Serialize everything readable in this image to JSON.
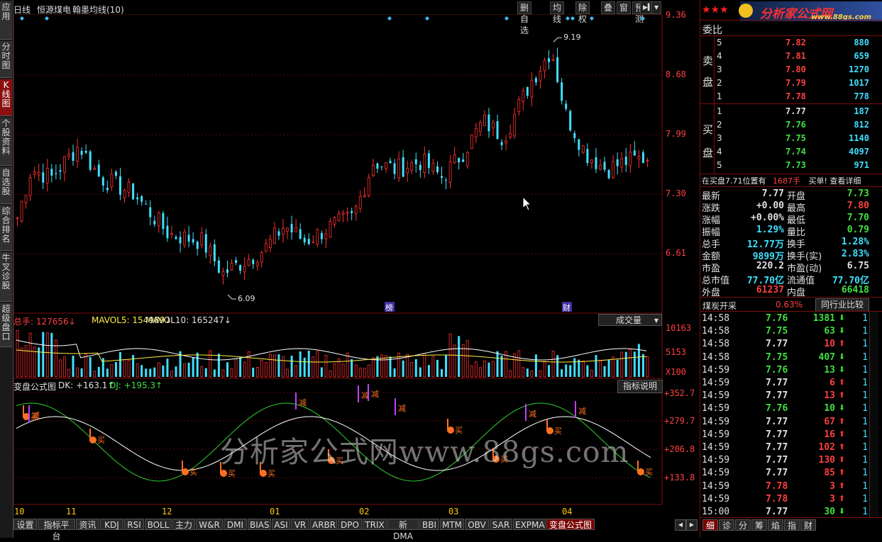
{
  "left_nav": [
    {
      "label": "应用",
      "active": false
    },
    {
      "label": "分时图",
      "active": false
    },
    {
      "label": "K线图",
      "active": true
    },
    {
      "label": "个股资料",
      "active": false
    },
    {
      "label": "自选股",
      "active": false
    },
    {
      "label": "综合排名",
      "active": false
    },
    {
      "label": "牛叉诊股",
      "active": false
    },
    {
      "label": "超级盘口",
      "active": false
    }
  ],
  "title": {
    "period": "日线",
    "stock": "恒源煤电",
    "indicator": "翰墨均线(10)"
  },
  "toolbar": [
    "删自选",
    "均线",
    "除权",
    "叠",
    "窗",
    "预测"
  ],
  "price_axis": [
    "9.36",
    "8.68",
    "7.99",
    "7.30",
    "6.61"
  ],
  "annotations": {
    "high": "9.19",
    "low": "6.09",
    "marker1": "榜",
    "marker2": "财"
  },
  "volume": {
    "label_total": "总手: 127656↓",
    "label_ma5": "MAVOL5: 154989↓",
    "label_ma10": "MAVOL10: 165247↓",
    "dropdown": "成交量",
    "axis": [
      "10163",
      "5153",
      "X100"
    ]
  },
  "indicator_panel": {
    "name": "变盘公式图",
    "dk": "DK: +163.1↑",
    "dj": "DJ: +195.3↑",
    "help_button": "指标说明",
    "axis": [
      "+352.7",
      "+279.7",
      "+206.8",
      "+133.8"
    ],
    "buy_label": "买",
    "sell_label": "减"
  },
  "watermark": "分析家公式网www.88gs.com",
  "x_axis": [
    "10",
    "11",
    "12",
    "01",
    "02",
    "03",
    "04"
  ],
  "bottom_tabs": [
    "设置",
    "指标平台",
    "资讯",
    "KDJ",
    "RSI",
    "BOLL",
    "主力",
    "W&R",
    "DMI",
    "BIAS",
    "ASI",
    "VR",
    "ARBR",
    "DPO",
    "TRIX",
    "新DMA",
    "BBI",
    "MTM",
    "OBV",
    "SAR",
    "EXPMA",
    "变盘公式图"
  ],
  "logo": {
    "stars": "★★★",
    "text": "分析家公式网",
    "url": "www.88gs.com"
  },
  "order_book": {
    "ratio_label": "委比",
    "sell_label_1": "卖",
    "sell_label_2": "盘",
    "buy_label_1": "买",
    "buy_label_2": "盘",
    "sell": [
      {
        "level": "5",
        "price": "7.82",
        "vol": "880"
      },
      {
        "level": "4",
        "price": "7.81",
        "vol": "659"
      },
      {
        "level": "3",
        "price": "7.80",
        "vol": "1270"
      },
      {
        "level": "2",
        "price": "7.79",
        "vol": "1017"
      },
      {
        "level": "1",
        "price": "7.78",
        "vol": "778"
      }
    ],
    "buy": [
      {
        "level": "1",
        "price": "7.77",
        "vol": "187"
      },
      {
        "level": "2",
        "price": "7.76",
        "vol": "812"
      },
      {
        "level": "3",
        "price": "7.75",
        "vol": "1140"
      },
      {
        "level": "4",
        "price": "7.74",
        "vol": "4097"
      },
      {
        "level": "5",
        "price": "7.73",
        "vol": "971"
      }
    ],
    "info_line": "在买盘7.71位置有",
    "info_vol": "1687手",
    "info_buy": "买单!",
    "info_link": "查看详细"
  },
  "quote": [
    {
      "k1": "最新",
      "v1": "7.77",
      "c1": "#e0e0e0",
      "k2": "开盘",
      "v2": "7.73",
      "c2": "#40e040"
    },
    {
      "k1": "涨跌",
      "v1": "+0.00",
      "c1": "#e0e0e0",
      "k2": "最高",
      "v2": "7.80",
      "c2": "#ff4040"
    },
    {
      "k1": "涨幅",
      "v1": "+0.00%",
      "c1": "#e0e0e0",
      "k2": "最低",
      "v2": "7.70",
      "c2": "#40e040"
    },
    {
      "k1": "振幅",
      "v1": "1.29%",
      "c1": "#40e0ff",
      "k2": "量比",
      "v2": "0.79",
      "c2": "#40e040"
    },
    {
      "k1": "总手",
      "v1": "12.77万",
      "c1": "#40e0ff",
      "k2": "换手",
      "v2": "1.28%",
      "c2": "#40e0ff"
    },
    {
      "k1": "金额",
      "v1": "9899万",
      "c1": "#40e0ff",
      "k2": "换手(实)",
      "v2": "2.83%",
      "c2": "#40e0ff"
    },
    {
      "k1": "市盈",
      "v1": "220.2",
      "c1": "#e0e0e0",
      "k2": "市盈(动)",
      "v2": "6.75",
      "c2": "#e0e0e0"
    },
    {
      "k1": "总市值",
      "v1": "77.70亿",
      "c1": "#40e0ff",
      "k2": "流通值",
      "v2": "77.70亿",
      "c2": "#40e0ff"
    },
    {
      "k1": "外盘",
      "v1": "61237",
      "c1": "#ff4040",
      "k2": "内盘",
      "v2": "66418",
      "c2": "#40e040"
    }
  ],
  "sector": {
    "name": "煤炭开采",
    "change": "0.63%",
    "compare_button": "同行业比较"
  },
  "ticks": [
    {
      "t": "14:58",
      "p": "7.76",
      "pc": "#40e040",
      "v": "1381",
      "dir": "down",
      "n": "1"
    },
    {
      "t": "14:58",
      "p": "7.75",
      "pc": "#40e040",
      "v": "63",
      "dir": "down",
      "n": "1"
    },
    {
      "t": "14:58",
      "p": "7.77",
      "pc": "#e0e0e0",
      "v": "10",
      "dir": "up",
      "n": "1"
    },
    {
      "t": "14:58",
      "p": "7.75",
      "pc": "#40e040",
      "v": "407",
      "dir": "down",
      "n": "1"
    },
    {
      "t": "14:59",
      "p": "7.76",
      "pc": "#40e040",
      "v": "13",
      "dir": "down",
      "n": "1"
    },
    {
      "t": "14:59",
      "p": "7.77",
      "pc": "#e0e0e0",
      "v": "6",
      "dir": "up",
      "n": "1"
    },
    {
      "t": "14:59",
      "p": "7.77",
      "pc": "#e0e0e0",
      "v": "13",
      "dir": "up",
      "n": "1"
    },
    {
      "t": "14:59",
      "p": "7.76",
      "pc": "#40e040",
      "v": "10",
      "dir": "down",
      "n": "1"
    },
    {
      "t": "14:59",
      "p": "7.77",
      "pc": "#e0e0e0",
      "v": "67",
      "dir": "up",
      "n": "1"
    },
    {
      "t": "14:59",
      "p": "7.77",
      "pc": "#e0e0e0",
      "v": "16",
      "dir": "up",
      "n": "1"
    },
    {
      "t": "14:59",
      "p": "7.77",
      "pc": "#e0e0e0",
      "v": "102",
      "dir": "up",
      "n": "1"
    },
    {
      "t": "14:59",
      "p": "7.77",
      "pc": "#e0e0e0",
      "v": "130",
      "dir": "up",
      "n": "1"
    },
    {
      "t": "14:59",
      "p": "7.77",
      "pc": "#e0e0e0",
      "v": "85",
      "dir": "up",
      "n": "1"
    },
    {
      "t": "14:59",
      "p": "7.78",
      "pc": "#ff4040",
      "v": "3",
      "dir": "up",
      "n": "1"
    },
    {
      "t": "14:59",
      "p": "7.78",
      "pc": "#ff4040",
      "v": "3",
      "dir": "up",
      "n": "1"
    },
    {
      "t": "15:00",
      "p": "7.77",
      "pc": "#e0e0e0",
      "v": "30",
      "dir": "down",
      "n": "1"
    }
  ],
  "right_tabs": [
    "细",
    "诊",
    "分",
    "筹",
    "焰",
    "指",
    "财"
  ],
  "colors": {
    "up": "#ff3030",
    "down": "#40e0ff",
    "border": "#7a0d0d",
    "accent": "#ffcc00"
  }
}
